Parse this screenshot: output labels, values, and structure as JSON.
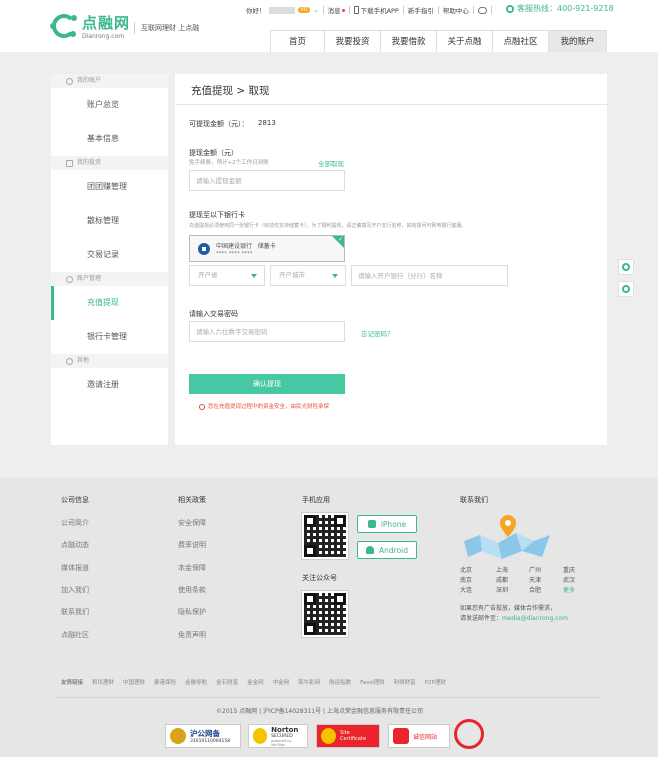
{
  "header": {
    "logo_cn": "点融网",
    "logo_en": "Dianrong.com",
    "slogan": "互联网理财 上点融",
    "greeting": "你好！",
    "vip": "V0",
    "messages": "消息",
    "download_app": "下载手机APP",
    "guide": "新手指引",
    "help": "帮助中心",
    "hotline": "客服热线：400-921-9218",
    "nav": [
      "首页",
      "我要投资",
      "我要借款",
      "关于点融",
      "点融社区",
      "我的账户"
    ],
    "nav_active": "我的账户"
  },
  "sidebar": {
    "groups": [
      {
        "title": "我的账户",
        "items": [
          "账户总览",
          "基本信息"
        ]
      },
      {
        "title": "我的投资",
        "items": [
          "团团赚管理",
          "散标管理",
          "交易记录"
        ]
      },
      {
        "title": "账户管理",
        "items": [
          "充值提现",
          "银行卡管理"
        ]
      },
      {
        "title": "其他",
        "items": [
          "邀请注册"
        ]
      }
    ],
    "active_item": "充值提现"
  },
  "withdraw": {
    "title": "充值提现 > 取现",
    "available_label": "可提现金额（元）：",
    "available_value": "2813",
    "amount_label": "提现金额（元）",
    "amount_hint": "免手续费，预计+2个工作日到账",
    "withdraw_all": "全部取现",
    "amount_placeholder": "请输入提现金额",
    "card_label": "提现至以下银行卡",
    "card_hint": "充值提现必须使用同一张银行卡（目前仅支持储蓄卡），为了顺利提现，请正确填写开户支行名称，如有疑问可致电银行客服。",
    "bank_name": "中国建设银行",
    "card_type": "储蓄卡",
    "card_number": "**** **** **** ",
    "province_placeholder": "开户省",
    "city_placeholder": "开户城市",
    "branch_placeholder": "请输入开户银行（分行）名称",
    "password_label": "请输入交易密码",
    "password_placeholder": "请输入六位数字交易密码",
    "forgot_password": "忘记密码？",
    "confirm_button": "确认提现",
    "warning": "您在充值提现过程中的资金安全，由民光财险承保"
  },
  "footer": {
    "company_title": "公司信息",
    "company_links": [
      "公司简介",
      "点融动态",
      "媒体报道",
      "加入我们",
      "联系我们",
      "点融社区"
    ],
    "policy_title": "相关政策",
    "policy_links": [
      "安全保障",
      "费率说明",
      "本金保障",
      "使用条款",
      "隐私保护",
      "免责声明"
    ],
    "mobile_title": "手机应用",
    "iphone": "iPhone",
    "android": "Android",
    "wechat_title": "关注公众号",
    "contact_title": "联系我们",
    "cities": [
      "北京",
      "上海",
      "广州",
      "重庆",
      "南京",
      "成都",
      "天津",
      "武汉",
      "大连",
      "深圳",
      "合肥",
      "更多"
    ],
    "contact_text_1": "如果您有广告投放，媒体合作需求，",
    "contact_text_2": "请发送邮件至：",
    "contact_email": "media@dianrong.com",
    "friend_label": "友情链接",
    "friend_links": [
      "和讯理财",
      "中国理财",
      "泰港保险",
      "金融导航",
      "金石财富",
      "金金网",
      "中金网",
      "菜牛影网",
      "航运指数",
      "Fessi理财",
      "利得财富",
      "P2P理财"
    ],
    "copyright": "©2015 点融网  |  沪ICP备14028311号  |  上海点荣金融信息服务有限责任公司",
    "badges": {
      "police": "沪公网备",
      "police_no": "31010110004158",
      "norton": "Norton",
      "norton_sub": "SECURED",
      "norton_by": "powered by VeriSign",
      "site_cert": "Site Certificate",
      "trust": "诚信网站"
    }
  },
  "colors": {
    "brand": "#3cb88a",
    "button": "#46c9a2",
    "warning": "#e94e3b"
  }
}
